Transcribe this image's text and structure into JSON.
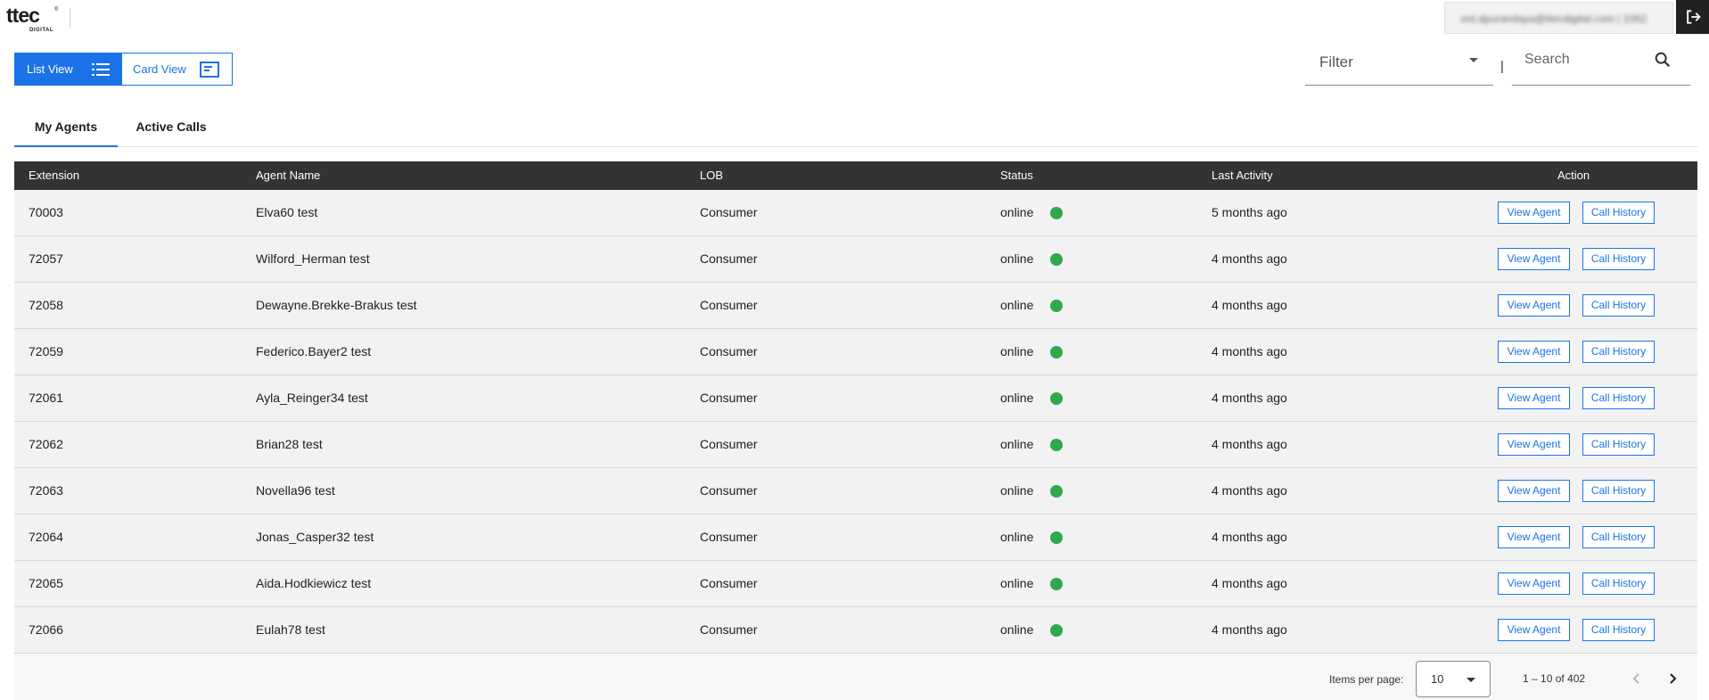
{
  "brand": {
    "logo_text": "ttec",
    "logo_sub": "DIGITAL",
    "logo_reg": "®"
  },
  "user": {
    "email": "ext.dpurandaya@ttecdigital.com | 1062",
    "logout_icon": "logout-icon"
  },
  "view_toggle": {
    "list_label": "List View",
    "card_label": "Card View",
    "active": "list"
  },
  "filter": {
    "label": "Filter"
  },
  "separator": "|",
  "search": {
    "placeholder": "Search"
  },
  "tabs": [
    {
      "label": "My Agents",
      "active": true
    },
    {
      "label": "Active Calls",
      "active": false
    }
  ],
  "table": {
    "headers": {
      "extension": "Extension",
      "agent_name": "Agent Name",
      "lob": "LOB",
      "status": "Status",
      "last_activity": "Last Activity",
      "action": "Action"
    },
    "action_labels": {
      "view": "View Agent",
      "history": "Call History"
    },
    "rows": [
      {
        "extension": "70003",
        "agent_name": "Elva60 test",
        "lob": "Consumer",
        "status": "online",
        "last_activity": "5 months ago"
      },
      {
        "extension": "72057",
        "agent_name": "Wilford_Herman test",
        "lob": "Consumer",
        "status": "online",
        "last_activity": "4 months ago"
      },
      {
        "extension": "72058",
        "agent_name": "Dewayne.Brekke-Brakus test",
        "lob": "Consumer",
        "status": "online",
        "last_activity": "4 months ago"
      },
      {
        "extension": "72059",
        "agent_name": "Federico.Bayer2 test",
        "lob": "Consumer",
        "status": "online",
        "last_activity": "4 months ago"
      },
      {
        "extension": "72061",
        "agent_name": "Ayla_Reinger34 test",
        "lob": "Consumer",
        "status": "online",
        "last_activity": "4 months ago"
      },
      {
        "extension": "72062",
        "agent_name": "Brian28 test",
        "lob": "Consumer",
        "status": "online",
        "last_activity": "4 months ago"
      },
      {
        "extension": "72063",
        "agent_name": "Novella96 test",
        "lob": "Consumer",
        "status": "online",
        "last_activity": "4 months ago"
      },
      {
        "extension": "72064",
        "agent_name": "Jonas_Casper32 test",
        "lob": "Consumer",
        "status": "online",
        "last_activity": "4 months ago"
      },
      {
        "extension": "72065",
        "agent_name": "Aida.Hodkiewicz test",
        "lob": "Consumer",
        "status": "online",
        "last_activity": "4 months ago"
      },
      {
        "extension": "72066",
        "agent_name": "Eulah78 test",
        "lob": "Consumer",
        "status": "online",
        "last_activity": "4 months ago"
      }
    ]
  },
  "paginator": {
    "items_per_page_label": "Items per page:",
    "items_per_page": "10",
    "range_label": "1 – 10 of 402"
  },
  "colors": {
    "accent": "#1a73e8",
    "header_bg": "#333333",
    "row_bg": "#f2f2f2",
    "status_online": "#2fa84f"
  }
}
